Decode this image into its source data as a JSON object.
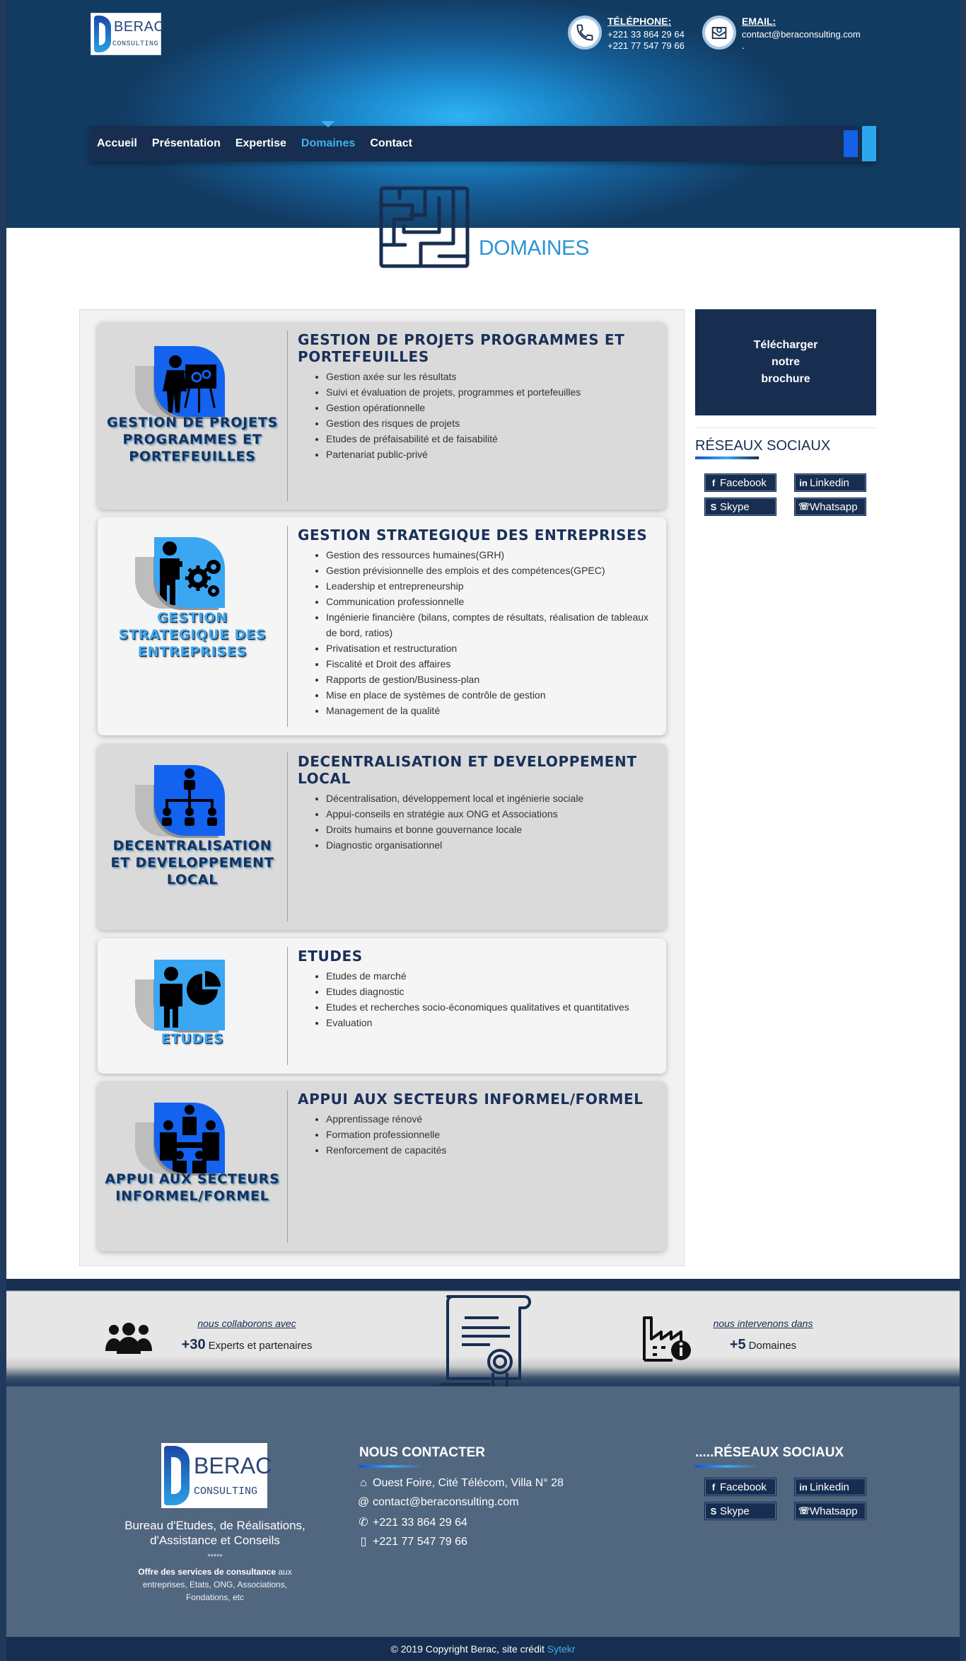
{
  "header": {
    "logo": {
      "name": "BERAC",
      "sub": "CONSULTING"
    },
    "phone": {
      "label": "TÉLÉPHONE:",
      "numbers": [
        "+221 33 864 29 64",
        "+221 77 547 79 66"
      ]
    },
    "email": {
      "label": "EMAIL:",
      "address": "contact@beraconsulting.com",
      "extra": "."
    },
    "nav": {
      "items": [
        "Accueil",
        "Présentation",
        "Expertise",
        "Domaines",
        "Contact"
      ],
      "active": "Domaines"
    },
    "page_title": "DOMAINES"
  },
  "domains": [
    {
      "caption": "GESTION DE PROJETS PROGRAMMES ET PORTEFEUILLES",
      "title": "GESTION DE PROJETS PROGRAMMES ET PORTEFEUILLES",
      "icon": "presenter-icon",
      "items": [
        "Gestion axée sur les résultats",
        "Suivi et évaluation de projets, programmes et portefeuilles",
        "Gestion opérationnelle",
        "Gestion des risques de projets",
        "Etudes de préfaisabilité et de faisabilité",
        "Partenariat public-privé"
      ]
    },
    {
      "caption": "GESTION STRATEGIQUE DES ENTREPRISES",
      "title": "GESTION STRATEGIQUE DES ENTREPRISES",
      "icon": "manager-gears-icon",
      "items": [
        "Gestion des ressources humaines(GRH)",
        "Gestion prévisionnelle des emplois et des compétences(GPEC)",
        "Leadership et entrepreneurship",
        "Communication professionnelle",
        "Ingénierie financière (bilans, comptes de résultats, réalisation de tableaux de bord, ratios)",
        "Privatisation et restructuration",
        "Fiscalité et Droit des affaires",
        "Rapports de gestion/Business-plan",
        "Mise en place de systèmes de contrôle de gestion",
        "Management de la qualité"
      ]
    },
    {
      "caption": "DECENTRALISATION ET DEVELOPPEMENT LOCAL",
      "title": "DECENTRALISATION ET DEVELOPPEMENT LOCAL",
      "icon": "org-chart-icon",
      "items": [
        "Décentralisation, développement local et ingénierie sociale",
        "Appui-conseils en stratégie aux ONG et Associations",
        "Droits humains et bonne gouvernance locale",
        "Diagnostic organisationnel"
      ]
    },
    {
      "caption": "ETUDES",
      "title": "ETUDES",
      "icon": "analyst-pie-icon",
      "items": [
        "Etudes de marché",
        "Etudes diagnostic",
        "Etudes et recherches socio-économiques qualitatives et quantitatives",
        "Evaluation"
      ]
    },
    {
      "caption": "APPUI AUX SECTEURS INFORMEL/FORMEL",
      "title": "APPUI AUX SECTEURS INFORMEL/FORMEL",
      "icon": "team-meeting-icon",
      "items": [
        "Apprentissage rénové",
        "Formation professionnelle",
        "Renforcement de capacités"
      ]
    }
  ],
  "sidebar": {
    "brochure_label": "Télécharger notre brochure",
    "social_title": "RÉSEAUX SOCIAUX",
    "social": [
      {
        "label": "Facebook",
        "icon": "facebook-icon"
      },
      {
        "label": "Linkedin",
        "icon": "linkedin-icon"
      },
      {
        "label": "Skype",
        "icon": "skype-icon"
      },
      {
        "label": "Whatsapp",
        "icon": "whatsapp-icon"
      }
    ]
  },
  "stats": {
    "collab": {
      "kicker": "nous collaborons avec",
      "value": "+30",
      "text": "Experts et partenaires"
    },
    "domains": {
      "kicker": "nous intervenons dans",
      "value": "+5",
      "text": "Domaines"
    }
  },
  "footer": {
    "tagline": "Bureau d'Etudes, de Réalisations, d'Assistance et Conseils",
    "stars": "*****",
    "offer_bold": "Offre des services de consultance",
    "offer_rest": " aux entreprises, Etats, ONG, Associations, Fondations, etc",
    "contact_title": "NOUS CONTACTER",
    "address": "Ouest Foire, Cité Télécom, Villa N° 28",
    "email": "contact@beraconsulting.com",
    "phone1": "+221 33 864 29 64",
    "phone2": "+221 77 547 79 66",
    "social_title": ".....RÉSEAUX SOCIAUX",
    "copyright": "© 2019 Copyright Berac, site crédit ",
    "credit": "Sytekr"
  },
  "colors": {
    "navy": "#172e50",
    "accent": "#3fb1ef",
    "blue": "#1362f0",
    "footer": "#51667f"
  }
}
